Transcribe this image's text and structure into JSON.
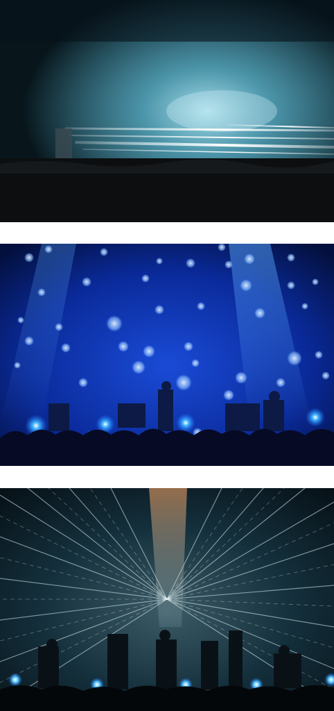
{
  "photos": [
    {
      "subject": "light-streaks-over-dark-crowd",
      "palette": {
        "bg": "#0b2a33",
        "glow": "#3fa9c9",
        "streak": "#e8f6ff",
        "crowd": "#0d0f12"
      }
    },
    {
      "subject": "blue-bokeh-concert-stage",
      "palette": {
        "bg": "#041a6e",
        "bokeh": "#7fb5ff",
        "light": "#2aa8ff",
        "crowd": "#0a0f2a"
      }
    },
    {
      "subject": "radial-light-burst-concert-stage",
      "palette": {
        "bg": "#0a1722",
        "streak": "#cfe3ea",
        "warm": "#d98a55",
        "crowd": "#06080b"
      }
    }
  ]
}
